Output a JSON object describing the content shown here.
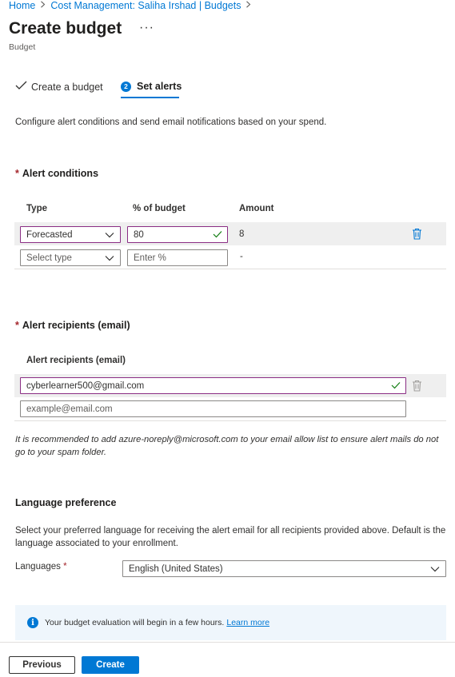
{
  "breadcrumb": {
    "home": "Home",
    "cost_management": "Cost Management: Saliha Irshad | Budgets"
  },
  "page": {
    "title": "Create budget",
    "subtitle": "Budget"
  },
  "tabs": {
    "step1_label": "Create a budget",
    "step2_number": "2",
    "step2_label": "Set alerts"
  },
  "intro": "Configure alert conditions and send email notifications based on your spend.",
  "alert_conditions": {
    "title": "Alert conditions",
    "columns": [
      "Type",
      "% of budget",
      "Amount"
    ],
    "rows": [
      {
        "type": "Forecasted",
        "percent": "80",
        "amount": "8"
      },
      {
        "type_placeholder": "Select type",
        "percent_placeholder": "Enter %",
        "amount": "-"
      }
    ]
  },
  "alert_recipients": {
    "title": "Alert recipients (email)",
    "column": "Alert recipients (email)",
    "email_value": "cyberlearner500@gmail.com",
    "email_placeholder": "example@email.com",
    "note": "It is recommended to add azure-noreply@microsoft.com to your email allow list to ensure alert mails do not go to your spam folder."
  },
  "language": {
    "title": "Language preference",
    "description": "Select your preferred language for receiving the alert email for all recipients provided above. Default is the language associated to your enrollment.",
    "label": "Languages",
    "required_mark": "*",
    "selected": "English (United States)"
  },
  "info": {
    "text": "Your budget evaluation will begin in a few hours.",
    "link": "Learn more"
  },
  "footer": {
    "previous": "Previous",
    "create": "Create"
  },
  "colors": {
    "accent": "#0078d4",
    "active_border": "#8a2d84",
    "required": "#a4262c",
    "valid_check": "#107c10"
  },
  "icons": [
    "chevron-right-icon",
    "more-icon",
    "check-icon",
    "chevron-down-icon",
    "trash-icon",
    "info-icon"
  ]
}
